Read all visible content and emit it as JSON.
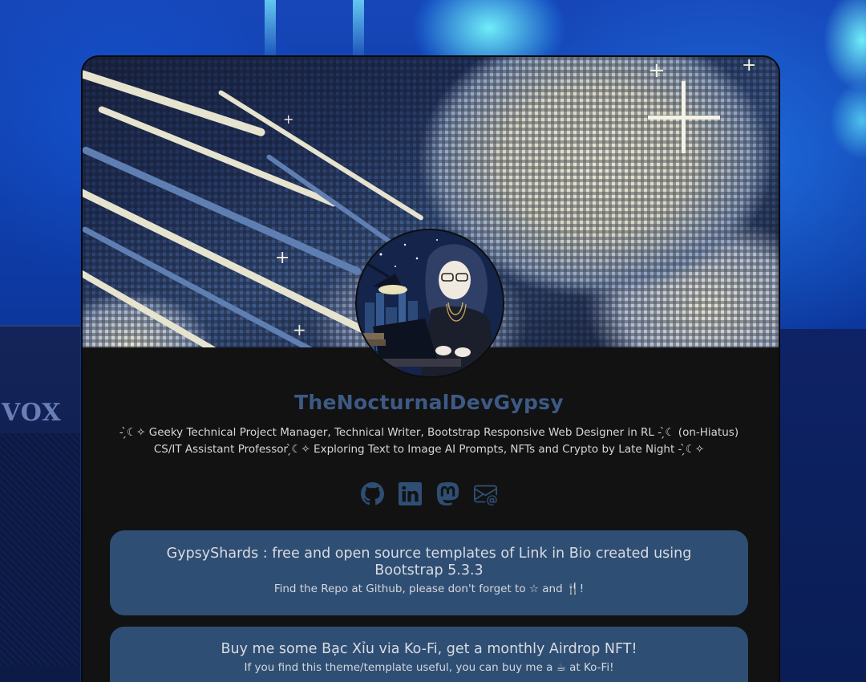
{
  "profile": {
    "name": "TheNocturnalDevGypsy",
    "bio": "- ̗̀☾✧ Geeky Technical Project Manager, Technical Writer, Bootstrap Responsive Web Designer in RL - ̗̀☾ (on-Hiatus) CS/IT Assistant Professor ̗̀☾✧ Exploring Text to Image AI Prompts, NFTs and Crypto by Late Night - ̗̀☾✧"
  },
  "background": {
    "amp_logo": "VOX"
  },
  "socials": [
    {
      "name": "github-icon"
    },
    {
      "name": "linkedin-icon"
    },
    {
      "name": "mastodon-icon"
    },
    {
      "name": "email-icon"
    }
  ],
  "links": [
    {
      "title": "GypsyShards : free and open source templates of Link in Bio created using Bootstrap 5.3.3",
      "subtitle": "Find the Repo at Github, please don't forget to ☆ and 🍴!"
    },
    {
      "title": "Buy me some Bạc Xỉu via Ko-Fi, get a monthly Airdrop NFT!",
      "subtitle": "If you find this theme/template useful, you can buy me a ☕ at Ko-Fi!"
    }
  ],
  "colors": {
    "card_bg": "#121212",
    "accent": "#3d5a85",
    "button_bg": "#2f4e73",
    "icon": "#2f4e73"
  }
}
